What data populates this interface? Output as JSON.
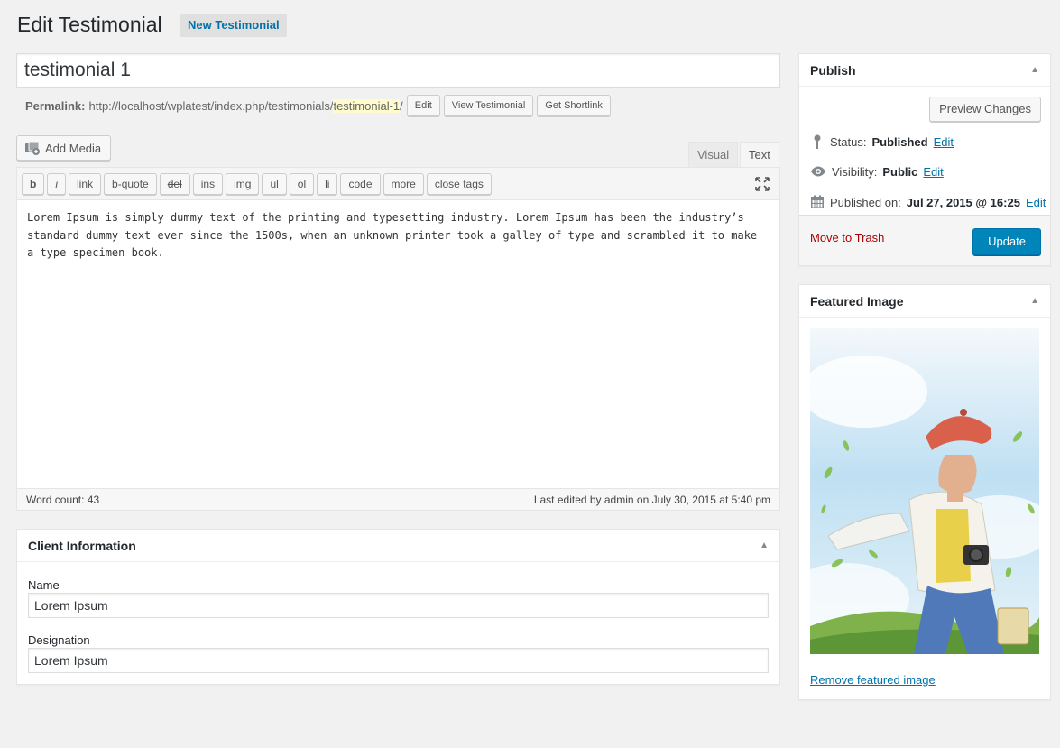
{
  "page": {
    "title": "Edit Testimonial",
    "add_new_label": "New Testimonial"
  },
  "post": {
    "title": "testimonial 1"
  },
  "permalink": {
    "label": "Permalink:",
    "base": "http://localhost/wplatest/index.php/testimonials/",
    "slug": "testimonial-1",
    "trailing": "/",
    "edit_label": "Edit",
    "view_label": "View Testimonial",
    "shortlink_label": "Get Shortlink"
  },
  "editor": {
    "add_media_label": "Add Media",
    "tabs": {
      "visual": "Visual",
      "text": "Text"
    },
    "quicktags": [
      "b",
      "i",
      "link",
      "b-quote",
      "del",
      "ins",
      "img",
      "ul",
      "ol",
      "li",
      "code",
      "more",
      "close tags"
    ],
    "content": "Lorem Ipsum is simply dummy text of the printing and typesetting industry. Lorem Ipsum has been the industry’s standard dummy text ever since the 1500s, when an unknown printer took a galley of type and scrambled it to make a type specimen book.",
    "word_count": "Word count: 43",
    "last_edited": "Last edited by admin on July 30, 2015 at 5:40 pm"
  },
  "client_info": {
    "title": "Client Information",
    "name_label": "Name",
    "name_value": "Lorem Ipsum",
    "designation_label": "Designation",
    "designation_value": "Lorem Ipsum"
  },
  "publish": {
    "title": "Publish",
    "preview_label": "Preview Changes",
    "status_label": "Status:",
    "status_value": "Published",
    "visibility_label": "Visibility:",
    "visibility_value": "Public",
    "published_label": "Published on:",
    "published_value": "Jul 27, 2015 @ 16:25",
    "edit_label": "Edit",
    "trash_label": "Move to Trash",
    "update_label": "Update"
  },
  "featured": {
    "title": "Featured Image",
    "remove_label": "Remove featured image"
  },
  "colors": {
    "primary": "#0085ba",
    "link": "#0073aa",
    "trash": "#aa0000",
    "slug_highlight": "#fffbcc"
  }
}
